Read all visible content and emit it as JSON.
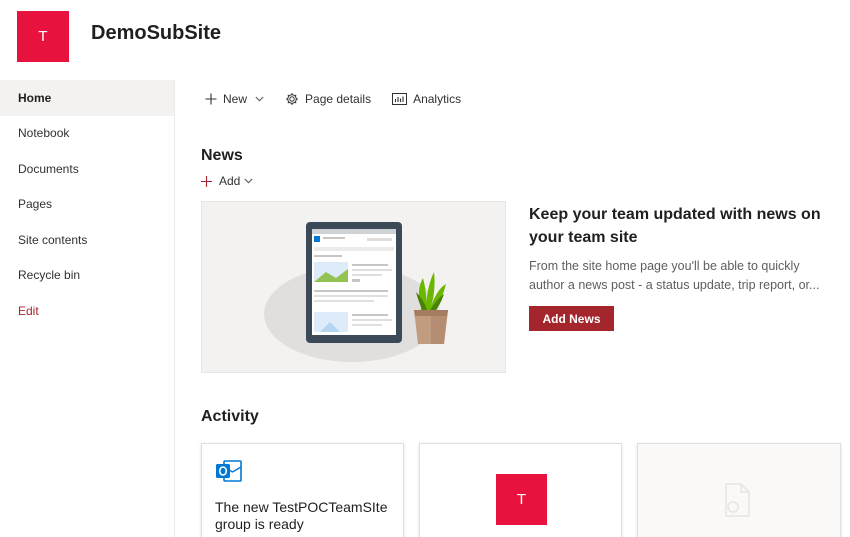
{
  "site": {
    "logo_letter": "T",
    "title": "DemoSubSite"
  },
  "nav": {
    "items": [
      {
        "label": "Home",
        "active": true
      },
      {
        "label": "Notebook"
      },
      {
        "label": "Documents"
      },
      {
        "label": "Pages"
      },
      {
        "label": "Site contents"
      },
      {
        "label": "Recycle bin"
      }
    ],
    "edit_label": "Edit"
  },
  "command_bar": {
    "new_label": "New",
    "page_details_label": "Page details",
    "analytics_label": "Analytics"
  },
  "news": {
    "title": "News",
    "add_label": "Add",
    "heading": "Keep your team updated with news on your team site",
    "description": "From the site home page you'll be able to quickly author a news post - a status update, trip report, or...",
    "button_label": "Add News"
  },
  "activity": {
    "title": "Activity",
    "cards": [
      {
        "icon": "outlook-icon",
        "text": "The new TestPOCTeamSIte group is ready"
      },
      {
        "icon": "group-logo",
        "logo_letter": "T"
      },
      {
        "icon": "file-icon"
      }
    ]
  },
  "colors": {
    "brand_red": "#e8123e",
    "accent_dark_red": "#a4262c",
    "nav_active_bg": "#f3f2f1"
  }
}
